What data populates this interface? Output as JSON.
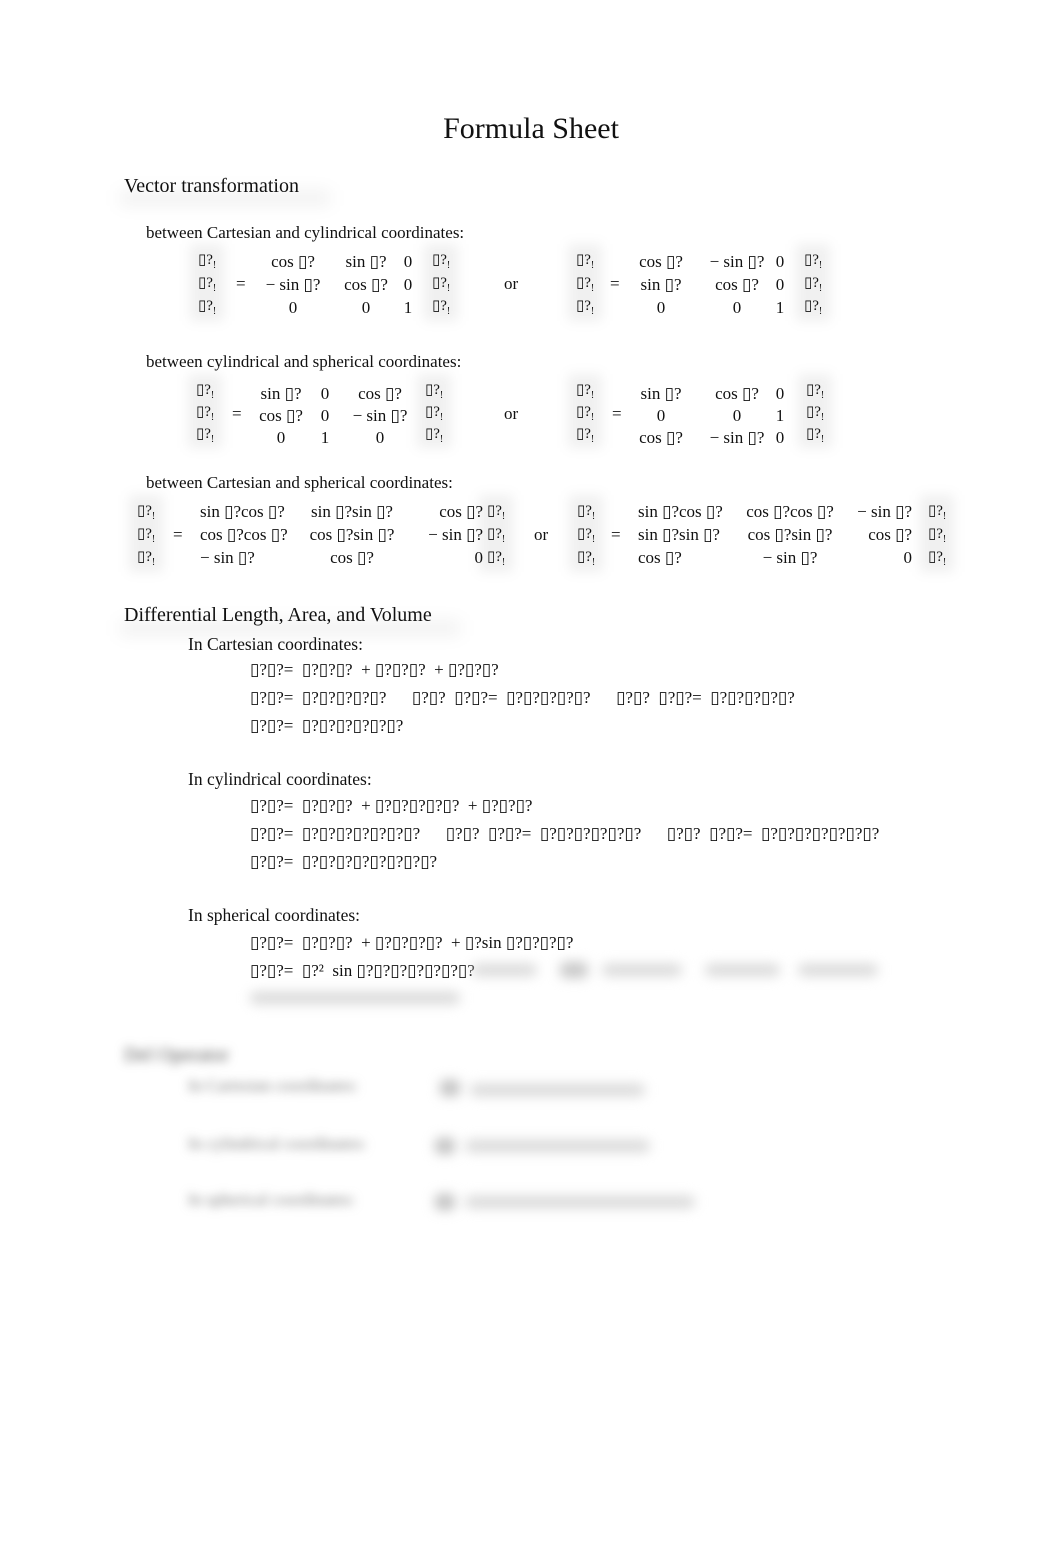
{
  "title": "Formula Sheet",
  "sections": {
    "vector": {
      "heading": "Vector transformation",
      "cart_cyl": {
        "label": "between Cartesian and cylindrical coordinates:",
        "or": "or",
        "eq": "=",
        "vec_glyph": "▯?",
        "vec_sub": "!",
        "left": [
          [
            "cos ▯?",
            "sin ▯?",
            "0"
          ],
          [
            "− sin ▯?",
            "cos ▯?",
            "0"
          ],
          [
            "0",
            "0",
            "1"
          ]
        ],
        "right": [
          [
            "cos ▯?",
            "− sin ▯?",
            "0"
          ],
          [
            "sin ▯?",
            "cos ▯?",
            "0"
          ],
          [
            "0",
            "0",
            "1"
          ]
        ]
      },
      "cyl_sph": {
        "label": "between cylindrical and spherical coordinates:",
        "or": "or",
        "eq": "=",
        "left": [
          [
            "sin ▯?",
            "0",
            "cos ▯?"
          ],
          [
            "cos ▯?",
            "0",
            "− sin ▯?"
          ],
          [
            "0",
            "1",
            "0"
          ]
        ],
        "right": [
          [
            "sin ▯?",
            "cos ▯?",
            "0"
          ],
          [
            "0",
            "0",
            "1"
          ],
          [
            "cos ▯?",
            "− sin ▯?",
            "0"
          ]
        ]
      },
      "cart_sph": {
        "label": "between Cartesian and spherical coordinates:",
        "or": "or",
        "eq": "=",
        "left": [
          [
            "sin ▯?cos ▯?",
            "sin ▯?sin ▯?",
            "cos ▯?"
          ],
          [
            "cos ▯?cos ▯?",
            "cos ▯?sin ▯?",
            "− sin ▯?"
          ],
          [
            "− sin ▯?",
            "cos ▯?",
            "0"
          ]
        ],
        "right": [
          [
            "sin ▯?cos ▯?",
            "cos ▯?cos ▯?",
            "− sin ▯?"
          ],
          [
            "sin ▯?sin ▯?",
            "cos ▯?sin ▯?",
            "cos ▯?"
          ],
          [
            "cos ▯?",
            "− sin ▯?",
            "0"
          ]
        ]
      }
    },
    "differential": {
      "heading": "Differential Length, Area, and Volume",
      "cartesian": {
        "label": "In Cartesian coordinates:",
        "lines": [
          "▯?▯?=  ▯?▯?▯?  + ▯?▯?▯?  + ▯?▯?▯?",
          "▯?▯?=  ▯?▯?▯?▯?▯?      ▯?▯?  ▯?▯?=  ▯?▯?▯?▯?▯?      ▯?▯?  ▯?▯?=  ▯?▯?▯?▯?▯?",
          "▯?▯?=  ▯?▯?▯?▯?▯?▯?"
        ]
      },
      "cylindrical": {
        "label": "In cylindrical coordinates:",
        "lines": [
          "▯?▯?=  ▯?▯?▯?  + ▯?▯?▯?▯?▯?  + ▯?▯?▯?",
          "▯?▯?=  ▯?▯?▯?▯?▯?▯?▯?      ▯?▯?  ▯?▯?=  ▯?▯?▯?▯?▯?▯?      ▯?▯?  ▯?▯?=  ▯?▯?▯?▯?▯?▯?▯?",
          "▯?▯?=  ▯?▯?▯?▯?▯?▯?▯?▯?"
        ]
      },
      "spherical": {
        "label": "In spherical coordinates:",
        "lines": [
          "▯?▯?=  ▯?▯?▯?  + ▯?▯?▯?▯?  + ▯?sin ▯?▯?▯?▯?",
          "▯?▯?=  ▯?²  sin ▯?▯?▯?▯?▯?▯?▯?"
        ]
      }
    },
    "del_operator": {
      "heading": "Del Operator",
      "rows": [
        {
          "label": "In Cartesian coordinates:"
        },
        {
          "label": "In cylindrical coordinates:"
        },
        {
          "label": "In spherical coordinates:"
        }
      ]
    }
  }
}
